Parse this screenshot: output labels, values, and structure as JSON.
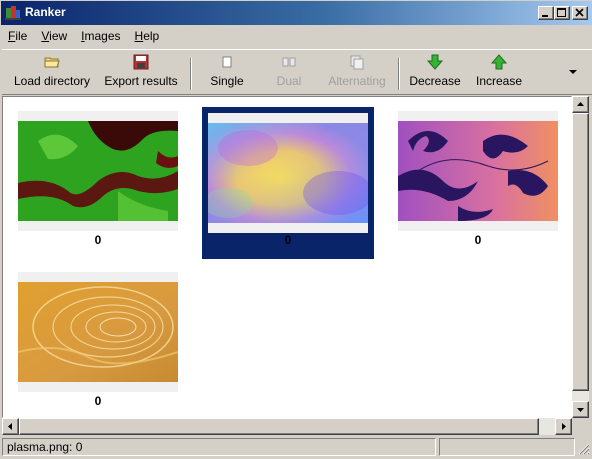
{
  "window": {
    "title": "Ranker"
  },
  "menu": [
    {
      "label": "File",
      "key": "F",
      "rest": "ile"
    },
    {
      "label": "View",
      "key": "V",
      "rest": "iew"
    },
    {
      "label": "Images",
      "key": "I",
      "rest": "mages"
    },
    {
      "label": "Help",
      "key": "H",
      "rest": "elp"
    }
  ],
  "toolbar": {
    "load_directory": "Load directory",
    "export_results": "Export results",
    "single": "Single",
    "dual": "Dual",
    "alternating": "Alternating",
    "decrease": "Decrease",
    "increase": "Increase"
  },
  "thumbnails": [
    {
      "score": "0",
      "selected": false,
      "icon": "green-fractal-image"
    },
    {
      "score": "0",
      "selected": true,
      "icon": "plasma-image"
    },
    {
      "score": "0",
      "selected": false,
      "icon": "purple-swirl-image"
    },
    {
      "score": "0",
      "selected": false,
      "icon": "golden-swirl-image"
    }
  ],
  "status": {
    "text": "plasma.png: 0"
  },
  "colors": {
    "selection": "#0a246a",
    "arrow_green": "#2fa82f"
  }
}
